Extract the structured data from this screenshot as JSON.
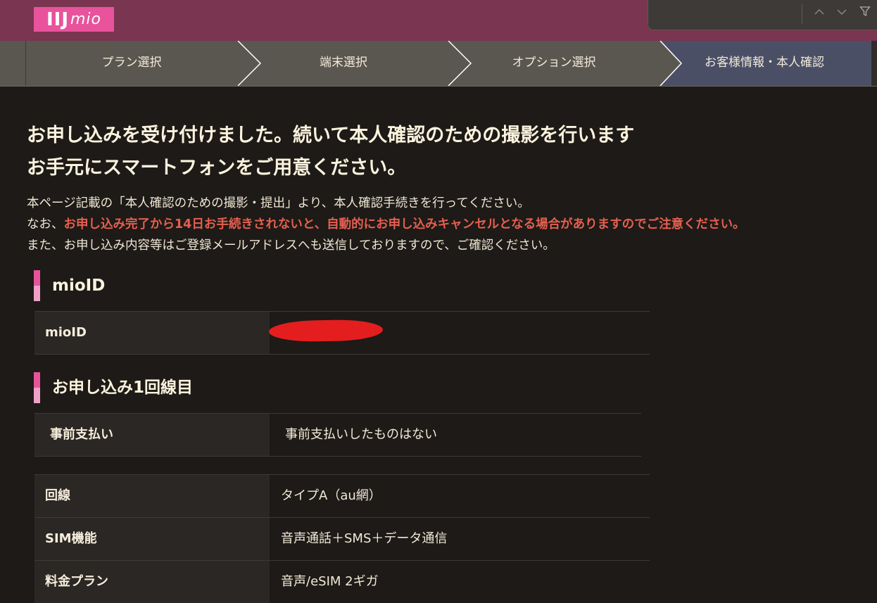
{
  "brand": {
    "logo_main": "IIJ",
    "logo_sub": "mio"
  },
  "findbar": {
    "up_icon": "chevron-up-icon",
    "down_icon": "chevron-down-icon",
    "filter_icon": "filter-icon"
  },
  "steps": [
    {
      "label": "プラン選択",
      "active": false
    },
    {
      "label": "端末選択",
      "active": false
    },
    {
      "label": "オプション選択",
      "active": false
    },
    {
      "label": "お客様情報・本人確認",
      "active": true
    }
  ],
  "headline": {
    "line1": "お申し込みを受け付けました。続いて本人確認のための撮影を行います",
    "line2": "お手元にスマートフォンをご用意ください。"
  },
  "intro": {
    "line1": "本ページ記載の「本人確認のための撮影・提出」より、本人確認手続きを行ってください。",
    "line2_prefix": "なお、",
    "line2_warning": "お申し込み完了から14日お手続きされないと、自動的にお申し込みキャンセルとなる場合がありますのでご注意ください。",
    "line3": "また、お申し込み内容等はご登録メールアドレスへも送信しておりますので、ご確認ください。"
  },
  "mioid_section": {
    "title": "mioID",
    "row_label": "mioID",
    "row_value_redacted": true
  },
  "line_section": {
    "title": "お申し込み1回線目",
    "prepay": {
      "label": "事前支払い",
      "value": "事前支払いしたものはない"
    },
    "rows": [
      {
        "label": "回線",
        "value": "タイプA（au網）"
      },
      {
        "label": "SIM機能",
        "value": "音声通話＋SMS＋データ通信"
      },
      {
        "label": "料金プラン",
        "value": "音声/eSIM 2ギガ"
      }
    ]
  },
  "colors": {
    "brand_pink": "#e8539c",
    "header_bg": "#7a3550",
    "warning": "#e65f4f",
    "active_step": "#4a4f66"
  }
}
